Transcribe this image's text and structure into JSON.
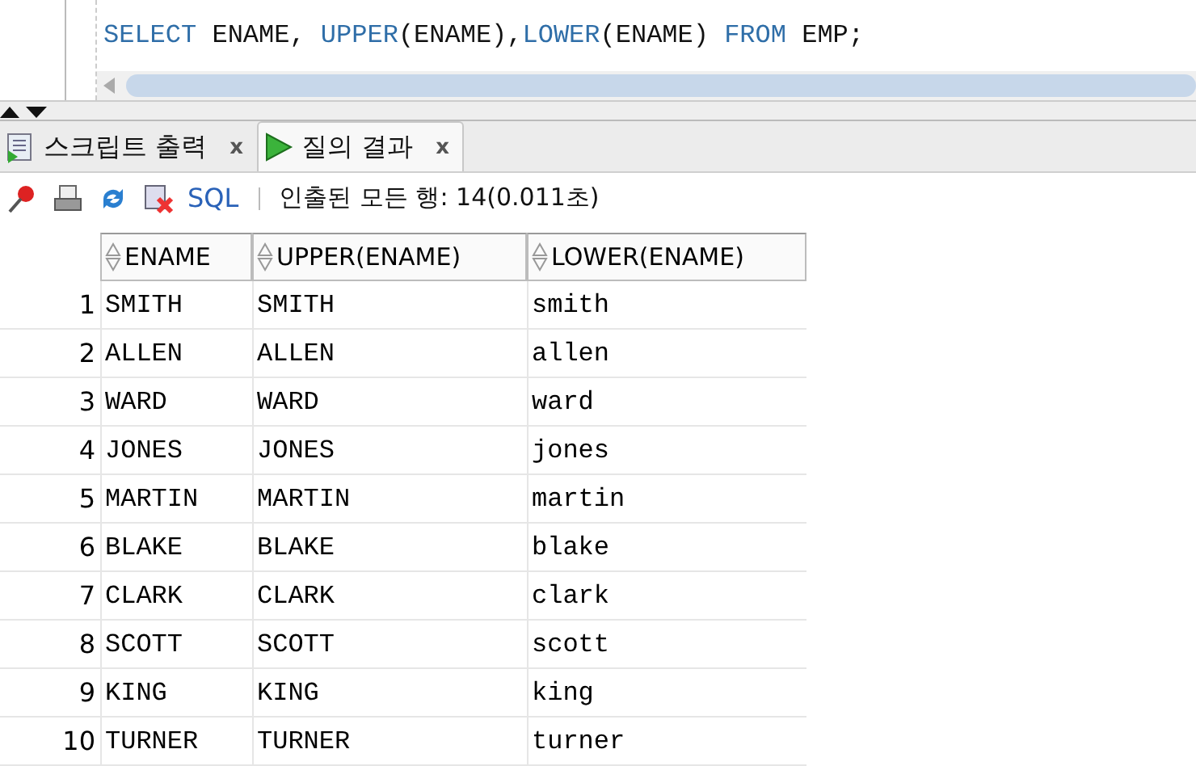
{
  "editor": {
    "tokens": [
      {
        "kind": "keyword",
        "text": "SELECT"
      },
      {
        "kind": "plain",
        "text": " ENAME, "
      },
      {
        "kind": "keyword",
        "text": "UPPER"
      },
      {
        "kind": "plain",
        "text": "(ENAME),"
      },
      {
        "kind": "keyword",
        "text": "LOWER"
      },
      {
        "kind": "plain",
        "text": "(ENAME) "
      },
      {
        "kind": "keyword",
        "text": "FROM"
      },
      {
        "kind": "plain",
        "text": " EMP;"
      }
    ]
  },
  "tabs": [
    {
      "label": "스크립트 출력",
      "close": "x",
      "selected": false,
      "kind": "script"
    },
    {
      "label": "질의 결과",
      "close": "x",
      "selected": true,
      "kind": "run"
    }
  ],
  "toolbar": {
    "sql_link": "SQL",
    "status": "인출된 모든 행: 14(0.011초)"
  },
  "table": {
    "columns": [
      "ENAME",
      "UPPER(ENAME)",
      "LOWER(ENAME)"
    ],
    "rows": [
      {
        "num": "1",
        "cells": [
          "SMITH",
          "SMITH",
          "smith"
        ]
      },
      {
        "num": "2",
        "cells": [
          "ALLEN",
          "ALLEN",
          "allen"
        ]
      },
      {
        "num": "3",
        "cells": [
          "WARD",
          "WARD",
          "ward"
        ]
      },
      {
        "num": "4",
        "cells": [
          "JONES",
          "JONES",
          "jones"
        ]
      },
      {
        "num": "5",
        "cells": [
          "MARTIN",
          "MARTIN",
          "martin"
        ]
      },
      {
        "num": "6",
        "cells": [
          "BLAKE",
          "BLAKE",
          "blake"
        ]
      },
      {
        "num": "7",
        "cells": [
          "CLARK",
          "CLARK",
          "clark"
        ]
      },
      {
        "num": "8",
        "cells": [
          "SCOTT",
          "SCOTT",
          "scott"
        ]
      },
      {
        "num": "9",
        "cells": [
          "KING",
          "KING",
          "king"
        ]
      },
      {
        "num": "10",
        "cells": [
          "TURNER",
          "TURNER",
          "turner"
        ]
      }
    ]
  }
}
